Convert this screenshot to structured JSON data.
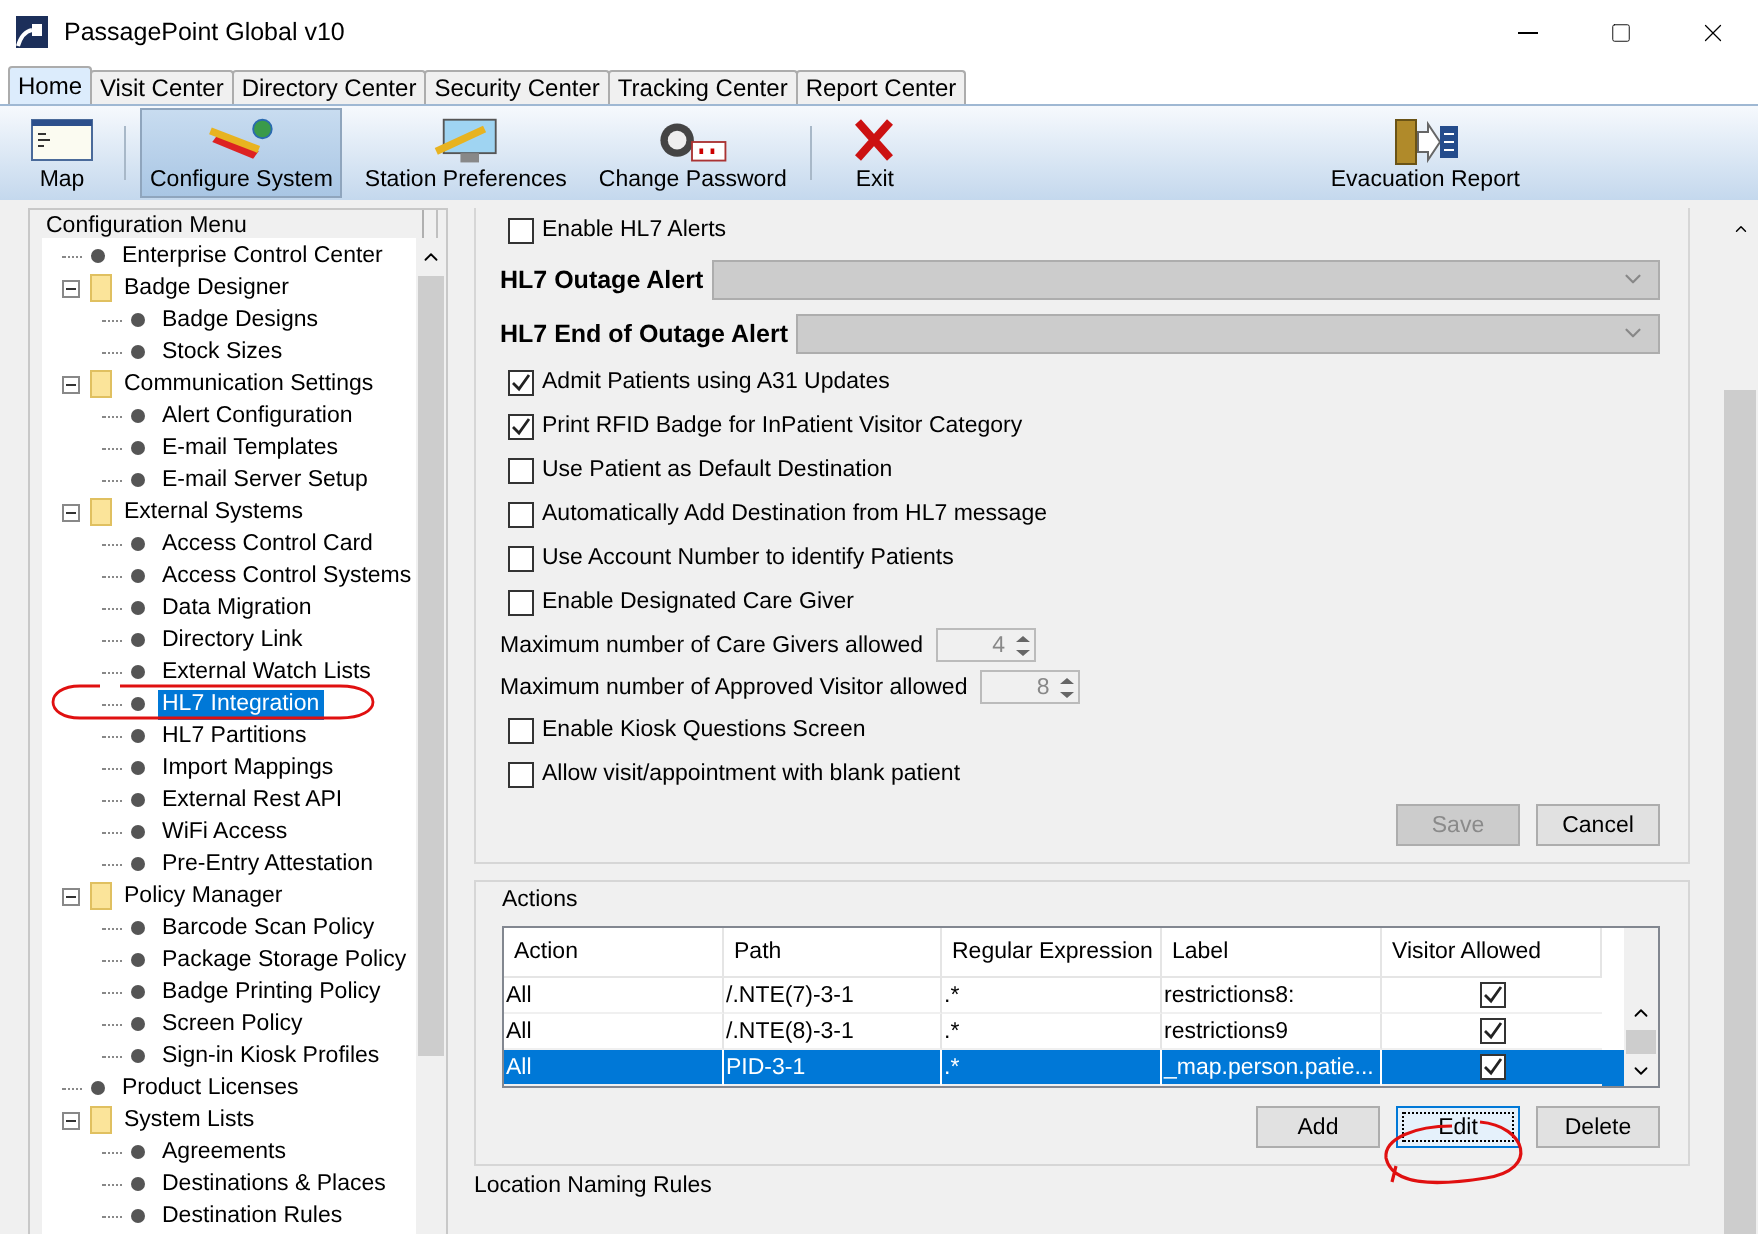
{
  "window": {
    "title": "PassagePoint Global v10"
  },
  "tabs": [
    {
      "label": "Home",
      "selected": true
    },
    {
      "label": "Visit Center",
      "selected": false
    },
    {
      "label": "Directory Center",
      "selected": false
    },
    {
      "label": "Security Center",
      "selected": false
    },
    {
      "label": "Tracking Center",
      "selected": false
    },
    {
      "label": "Report Center",
      "selected": false
    }
  ],
  "toolbar": {
    "left": [
      {
        "label": "Map",
        "selected": false
      },
      {
        "label": "Configure System",
        "selected": true
      },
      {
        "label": "Station Preferences",
        "selected": false
      },
      {
        "label": "Change Password",
        "selected": false
      },
      {
        "label": "Exit",
        "selected": false
      }
    ],
    "right": [
      {
        "label": "Evacuation Report",
        "selected": false
      }
    ]
  },
  "sidebar": {
    "title": "Configuration Menu",
    "items": [
      {
        "kind": "leaf",
        "label": "Enterprise Control Center",
        "selected": false
      },
      {
        "kind": "folder",
        "label": "Badge Designer",
        "expanded": true,
        "selected": false,
        "children": [
          {
            "kind": "leaf",
            "label": "Badge Designs",
            "selected": false
          },
          {
            "kind": "leaf",
            "label": "Stock Sizes",
            "selected": false
          }
        ]
      },
      {
        "kind": "folder",
        "label": "Communication Settings",
        "expanded": true,
        "selected": false,
        "children": [
          {
            "kind": "leaf",
            "label": "Alert Configuration",
            "selected": false
          },
          {
            "kind": "leaf",
            "label": "E-mail Templates",
            "selected": false
          },
          {
            "kind": "leaf",
            "label": "E-mail Server Setup",
            "selected": false
          }
        ]
      },
      {
        "kind": "folder",
        "label": "External Systems",
        "expanded": true,
        "selected": false,
        "children": [
          {
            "kind": "leaf",
            "label": "Access Control Card",
            "selected": false
          },
          {
            "kind": "leaf",
            "label": "Access Control Systems",
            "selected": false
          },
          {
            "kind": "leaf",
            "label": "Data Migration",
            "selected": false
          },
          {
            "kind": "leaf",
            "label": "Directory Link",
            "selected": false
          },
          {
            "kind": "leaf",
            "label": "External Watch Lists",
            "selected": false
          },
          {
            "kind": "leaf",
            "label": "HL7 Integration",
            "selected": true
          },
          {
            "kind": "leaf",
            "label": "HL7 Partitions",
            "selected": false
          },
          {
            "kind": "leaf",
            "label": "Import Mappings",
            "selected": false
          },
          {
            "kind": "leaf",
            "label": "External Rest API",
            "selected": false
          },
          {
            "kind": "leaf",
            "label": "WiFi Access",
            "selected": false
          },
          {
            "kind": "leaf",
            "label": "Pre-Entry Attestation",
            "selected": false
          }
        ]
      },
      {
        "kind": "folder",
        "label": "Policy Manager",
        "expanded": true,
        "selected": false,
        "children": [
          {
            "kind": "leaf",
            "label": "Barcode Scan Policy",
            "selected": false
          },
          {
            "kind": "leaf",
            "label": "Package Storage Policy",
            "selected": false
          },
          {
            "kind": "leaf",
            "label": "Badge Printing Policy",
            "selected": false
          },
          {
            "kind": "leaf",
            "label": "Screen Policy",
            "selected": false
          },
          {
            "kind": "leaf",
            "label": "Sign-in Kiosk Profiles",
            "selected": false
          }
        ]
      },
      {
        "kind": "leaf",
        "label": "Product Licenses",
        "selected": false
      },
      {
        "kind": "folder",
        "label": "System Lists",
        "expanded": true,
        "selected": false,
        "children": [
          {
            "kind": "leaf",
            "label": "Agreements",
            "selected": false
          },
          {
            "kind": "leaf",
            "label": "Destinations & Places",
            "selected": false
          },
          {
            "kind": "leaf",
            "label": "Destination Rules",
            "selected": false
          }
        ]
      }
    ]
  },
  "settings": {
    "rows": [
      {
        "kind": "checkbox",
        "label": "Enable HL7 Alerts",
        "checked": false
      },
      {
        "kind": "dropdown",
        "label": "HL7 Outage Alert",
        "disabled": true
      },
      {
        "kind": "dropdown",
        "label": "HL7 End of Outage Alert",
        "disabled": true
      },
      {
        "kind": "checkbox",
        "label": "Admit Patients using A31 Updates",
        "checked": true
      },
      {
        "kind": "checkbox",
        "label": "Print RFID Badge for InPatient Visitor Category",
        "checked": true
      },
      {
        "kind": "checkbox",
        "label": "Use Patient as Default Destination",
        "checked": false
      },
      {
        "kind": "checkbox",
        "label": "Automatically Add Destination from HL7 message",
        "checked": false
      },
      {
        "kind": "checkbox",
        "label": "Use Account Number to identify Patients",
        "checked": false
      },
      {
        "kind": "checkbox",
        "label": "Enable Designated Care Giver",
        "checked": false
      },
      {
        "kind": "spinner",
        "label": "Maximum number of Care Givers allowed",
        "value": "4",
        "disabled": true
      },
      {
        "kind": "spinner",
        "label": "Maximum number of Approved Visitor allowed",
        "value": "8",
        "disabled": true
      },
      {
        "kind": "checkbox",
        "label": "Enable Kiosk Questions Screen",
        "checked": false
      },
      {
        "kind": "checkbox",
        "label": "Allow visit/appointment with blank patient",
        "checked": false
      }
    ],
    "buttons": [
      {
        "label": "Save",
        "disabled": true
      },
      {
        "label": "Cancel",
        "disabled": false
      }
    ]
  },
  "actions": {
    "title": "Actions",
    "columns": [
      "Action",
      "Path",
      "Regular Expression",
      "Label",
      "Visitor Allowed"
    ],
    "rows": [
      {
        "cells": [
          "All",
          "/.NTE(7)-3-1",
          ".*",
          "restrictions8:"
        ],
        "visitor_allowed": true,
        "selected": false
      },
      {
        "cells": [
          "All",
          "/.NTE(8)-3-1",
          ".*",
          "restrictions9"
        ],
        "visitor_allowed": true,
        "selected": false
      },
      {
        "cells": [
          "All",
          "PID-3-1",
          ".*",
          "_map.person.patie..."
        ],
        "visitor_allowed": true,
        "selected": true
      }
    ],
    "buttons": [
      {
        "label": "Add",
        "focused": false
      },
      {
        "label": "Edit",
        "focused": true
      },
      {
        "label": "Delete",
        "focused": false
      }
    ]
  },
  "next_section": {
    "title": "Location Naming Rules"
  }
}
